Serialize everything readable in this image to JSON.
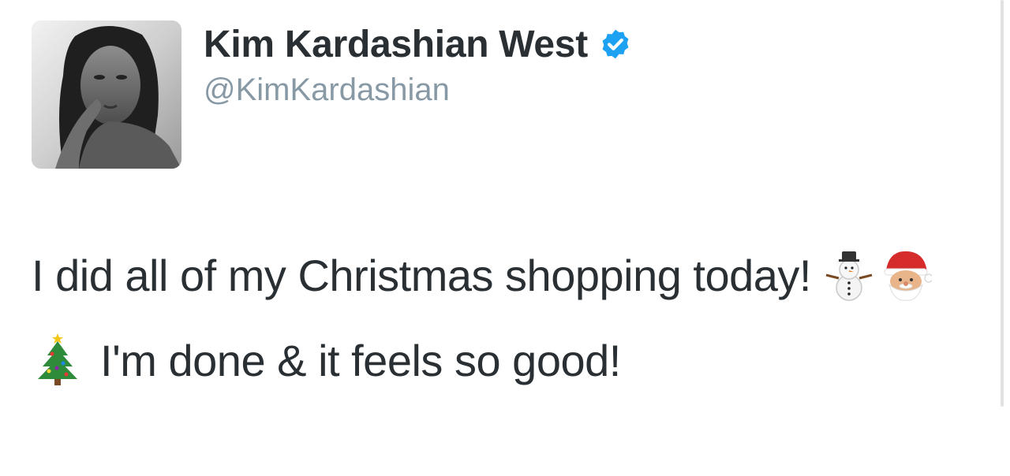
{
  "tweet": {
    "author": {
      "display_name": "Kim Kardashian West",
      "handle": "@KimKardashian",
      "verified": true,
      "verified_icon": "verified-badge-icon",
      "verified_color": "#1da1f2"
    },
    "text": {
      "part1": "I did all of my Christmas shopping today! ",
      "emojis": [
        "snowman-icon",
        "santa-icon",
        "christmas-tree-icon"
      ],
      "part2": " I'm done & it feels so good!"
    }
  }
}
